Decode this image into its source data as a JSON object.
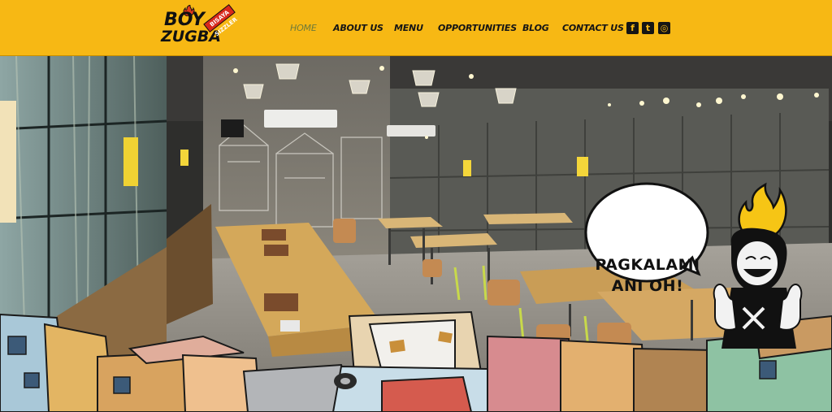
{
  "brand": {
    "line1": "BOY",
    "line2": "ZUGBA",
    "tagline": "BISAYA SIZZLER",
    "logo_icon": "flame-icon"
  },
  "nav": {
    "items": [
      {
        "label": "HOME",
        "active": true
      },
      {
        "label": "ABOUT US",
        "active": false
      },
      {
        "label": "MENU",
        "active": false
      },
      {
        "label": "OPPORTUNITIES",
        "active": false
      },
      {
        "label": "BLOG",
        "active": false
      },
      {
        "label": "CONTACT US",
        "active": false
      }
    ]
  },
  "social": [
    {
      "name": "facebook-icon",
      "glyph": "f"
    },
    {
      "name": "twitter-icon",
      "glyph": "t"
    },
    {
      "name": "instagram-icon",
      "glyph": "◎"
    }
  ],
  "hero": {
    "speech_line1": "PAGKALAMI",
    "speech_line2": "ANI OH!"
  },
  "colors": {
    "header": "#f7b814",
    "nav_text": "#151515",
    "nav_active": "#6e7a3a"
  }
}
